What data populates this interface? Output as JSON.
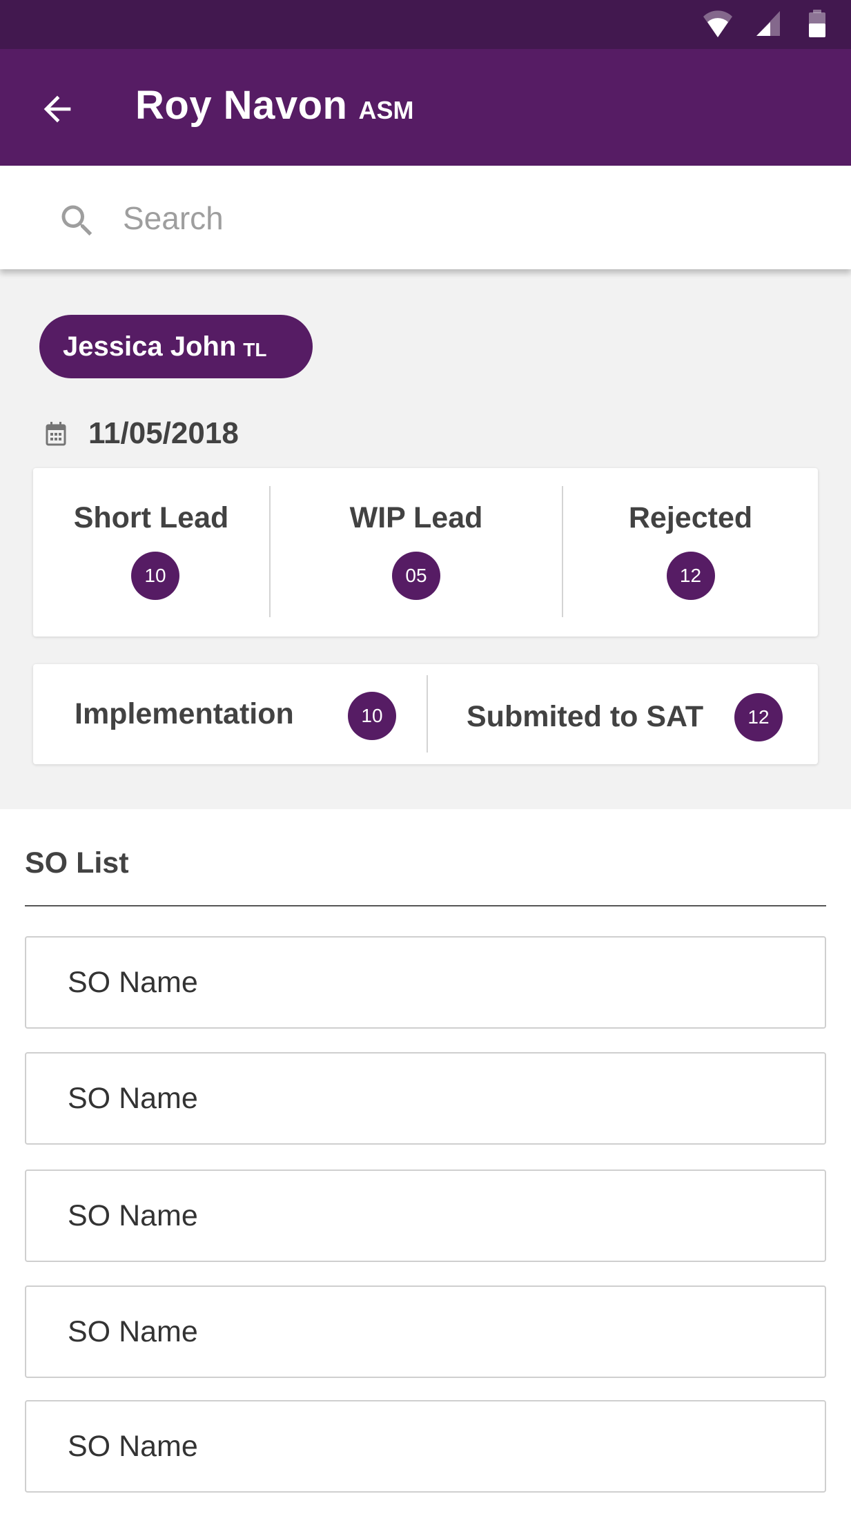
{
  "header": {
    "title": "Roy Navon",
    "role": "ASM"
  },
  "search": {
    "placeholder": "Search",
    "value": ""
  },
  "filter_chip": {
    "name": "Jessica John",
    "role": "TL"
  },
  "date": "11/05/2018",
  "stats_top": [
    {
      "label": "Short Lead",
      "count": "10"
    },
    {
      "label": "WIP Lead",
      "count": "05"
    },
    {
      "label": "Rejected",
      "count": "12"
    }
  ],
  "stats_bottom": [
    {
      "label": "Implementation",
      "count": "10"
    },
    {
      "label": "Submited to SAT",
      "count": "12"
    }
  ],
  "so_list": {
    "heading": "SO List",
    "items": [
      "SO Name",
      "SO Name",
      "SO Name",
      "SO Name",
      "SO Name"
    ]
  },
  "colors": {
    "status_bar": "#42184f",
    "primary": "#561c64",
    "summary_bg": "#f2f2f2"
  },
  "icons": {
    "status": [
      "wifi-icon",
      "signal-icon",
      "battery-icon"
    ],
    "back": "arrow-left-icon",
    "search": "search-icon",
    "date": "calendar-icon"
  }
}
